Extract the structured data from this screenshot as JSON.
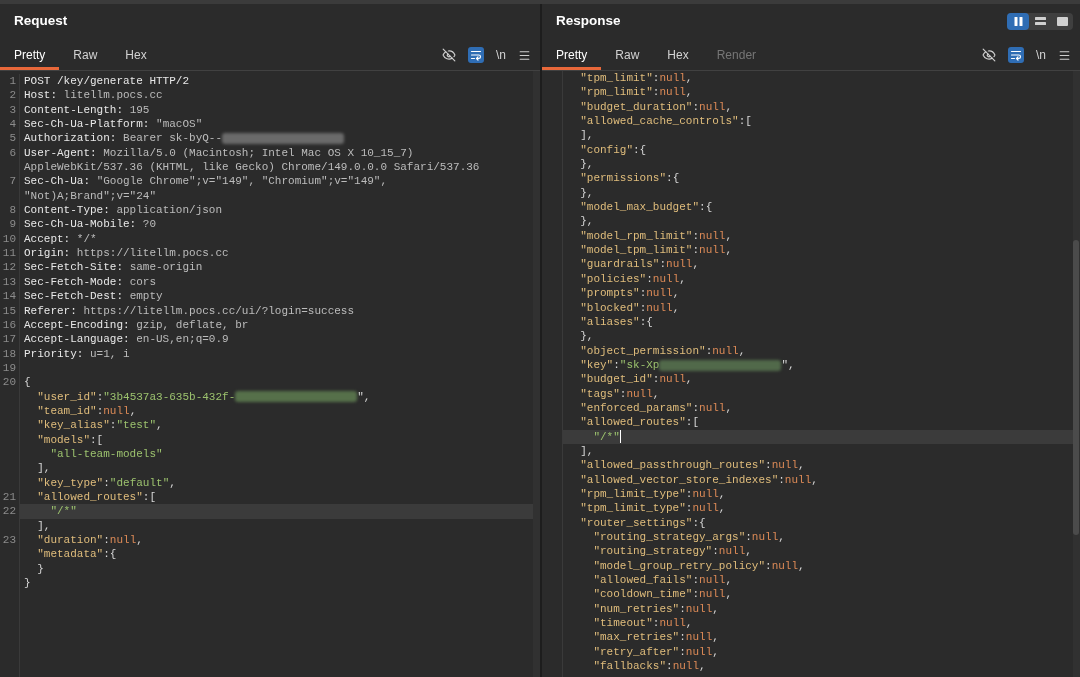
{
  "request": {
    "title": "Request",
    "tabs": [
      {
        "label": "Pretty",
        "selected": true,
        "disabled": false
      },
      {
        "label": "Raw",
        "selected": false,
        "disabled": false
      },
      {
        "label": "Hex",
        "selected": false,
        "disabled": false
      }
    ],
    "toolbar": {
      "wrap_on": true,
      "newline_label": "\\n"
    },
    "caret": false,
    "rows": [
      {
        "number": "1",
        "selected": false,
        "tokens": [
          {
            "kind": "name",
            "text": "POST /key/generate HTTP/2"
          }
        ]
      },
      {
        "number": "2",
        "selected": false,
        "tokens": [
          {
            "kind": "name",
            "text": "Host: "
          },
          {
            "kind": "value",
            "text": "litellm.pocs.cc"
          }
        ]
      },
      {
        "number": "3",
        "selected": false,
        "tokens": [
          {
            "kind": "name",
            "text": "Content-Length: "
          },
          {
            "kind": "value",
            "text": "195"
          }
        ]
      },
      {
        "number": "4",
        "selected": false,
        "tokens": [
          {
            "kind": "name",
            "text": "Sec-Ch-Ua-Platform: "
          },
          {
            "kind": "value",
            "text": "\"macOS\""
          }
        ]
      },
      {
        "number": "5",
        "selected": false,
        "tokens": [
          {
            "kind": "name",
            "text": "Authorization: "
          },
          {
            "kind": "value",
            "text": "Bearer sk-byQ--"
          },
          {
            "kind": "redacted",
            "color": "#6a6a6a"
          }
        ]
      },
      {
        "number": "6",
        "selected": false,
        "tokens": [
          {
            "kind": "name",
            "text": "User-Agent: "
          },
          {
            "kind": "value",
            "text": "Mozilla/5.0 (Macintosh; Intel Mac OS X 10_15_7)"
          }
        ]
      },
      {
        "selected": false,
        "tokens": [
          {
            "kind": "value",
            "text": "AppleWebKit/537.36 (KHTML, like Gecko) Chrome/149.0.0.0 Safari/537.36"
          }
        ]
      },
      {
        "number": "7",
        "selected": false,
        "tokens": [
          {
            "kind": "name",
            "text": "Sec-Ch-Ua: "
          },
          {
            "kind": "value",
            "text": "\"Google Chrome\";v=\"149\", \"Chromium\";v=\"149\","
          }
        ]
      },
      {
        "selected": false,
        "tokens": [
          {
            "kind": "value",
            "text": "\"Not)A;Brand\";v=\"24\""
          }
        ]
      },
      {
        "number": "8",
        "selected": false,
        "tokens": [
          {
            "kind": "name",
            "text": "Content-Type: "
          },
          {
            "kind": "value",
            "text": "application/json"
          }
        ]
      },
      {
        "number": "9",
        "selected": false,
        "tokens": [
          {
            "kind": "name",
            "text": "Sec-Ch-Ua-Mobile: "
          },
          {
            "kind": "value",
            "text": "?0"
          }
        ]
      },
      {
        "number": "10",
        "selected": false,
        "tokens": [
          {
            "kind": "name",
            "text": "Accept: "
          },
          {
            "kind": "value",
            "text": "*/*"
          }
        ]
      },
      {
        "number": "11",
        "selected": false,
        "tokens": [
          {
            "kind": "name",
            "text": "Origin: "
          },
          {
            "kind": "value",
            "text": "https://litellm.pocs.cc"
          }
        ]
      },
      {
        "number": "12",
        "selected": false,
        "tokens": [
          {
            "kind": "name",
            "text": "Sec-Fetch-Site: "
          },
          {
            "kind": "value",
            "text": "same-origin"
          }
        ]
      },
      {
        "number": "13",
        "selected": false,
        "tokens": [
          {
            "kind": "name",
            "text": "Sec-Fetch-Mode: "
          },
          {
            "kind": "value",
            "text": "cors"
          }
        ]
      },
      {
        "number": "14",
        "selected": false,
        "tokens": [
          {
            "kind": "name",
            "text": "Sec-Fetch-Dest: "
          },
          {
            "kind": "value",
            "text": "empty"
          }
        ]
      },
      {
        "number": "15",
        "selected": false,
        "tokens": [
          {
            "kind": "name",
            "text": "Referer: "
          },
          {
            "kind": "value",
            "text": "https://litellm.pocs.cc/ui/?login=success"
          }
        ]
      },
      {
        "number": "16",
        "selected": false,
        "tokens": [
          {
            "kind": "name",
            "text": "Accept-Encoding: "
          },
          {
            "kind": "value",
            "text": "gzip, deflate, br"
          }
        ]
      },
      {
        "number": "17",
        "selected": false,
        "tokens": [
          {
            "kind": "name",
            "text": "Accept-Language: "
          },
          {
            "kind": "value",
            "text": "en-US,en;q=0.9"
          }
        ]
      },
      {
        "number": "18",
        "selected": false,
        "tokens": [
          {
            "kind": "name",
            "text": "Priority: "
          },
          {
            "kind": "value",
            "text": "u=1, i"
          }
        ]
      },
      {
        "number": "19",
        "selected": false
      },
      {
        "number": "20",
        "selected": false,
        "tokens": [
          {
            "kind": "punct",
            "text": "{"
          }
        ]
      },
      {
        "selected": false,
        "tokens": [
          {
            "kind": "key",
            "text": "  \"user_id\""
          },
          {
            "kind": "punct",
            "text": ":"
          },
          {
            "kind": "string",
            "text": "\"3b4537a3-635b-432f-"
          },
          {
            "kind": "redacted",
            "color": "#56704a"
          },
          {
            "kind": "punct",
            "text": "\","
          }
        ]
      },
      {
        "selected": false,
        "tokens": [
          {
            "kind": "key",
            "text": "  \"team_id\""
          },
          {
            "kind": "punct",
            "text": ":"
          },
          {
            "kind": "null",
            "text": "null"
          },
          {
            "kind": "punct",
            "text": ","
          }
        ]
      },
      {
        "selected": false,
        "tokens": [
          {
            "kind": "key",
            "text": "  \"key_alias\""
          },
          {
            "kind": "punct",
            "text": ":"
          },
          {
            "kind": "string",
            "text": "\"test\""
          },
          {
            "kind": "punct",
            "text": ","
          }
        ]
      },
      {
        "selected": false,
        "tokens": [
          {
            "kind": "key",
            "text": "  \"models\""
          },
          {
            "kind": "punct",
            "text": ":["
          }
        ]
      },
      {
        "selected": false,
        "tokens": [
          {
            "kind": "string",
            "text": "    \"all-team-models\""
          }
        ]
      },
      {
        "selected": false,
        "tokens": [
          {
            "kind": "punct",
            "text": "  ],"
          }
        ]
      },
      {
        "selected": false,
        "tokens": [
          {
            "kind": "key",
            "text": "  \"key_type\""
          },
          {
            "kind": "punct",
            "text": ":"
          },
          {
            "kind": "string",
            "text": "\"default\""
          },
          {
            "kind": "punct",
            "text": ","
          }
        ]
      },
      {
        "number": "21",
        "selected": false,
        "tokens": [
          {
            "kind": "key",
            "text": "  \"allowed_routes\""
          },
          {
            "kind": "punct",
            "text": ":["
          }
        ]
      },
      {
        "number": "22",
        "selected": true,
        "tokens": [
          {
            "kind": "string",
            "text": "    \"/*\""
          }
        ]
      },
      {
        "selected": false,
        "tokens": [
          {
            "kind": "punct",
            "text": "  ],"
          }
        ]
      },
      {
        "number": "23",
        "selected": false,
        "tokens": [
          {
            "kind": "key",
            "text": "  \"duration\""
          },
          {
            "kind": "punct",
            "text": ":"
          },
          {
            "kind": "null",
            "text": "null"
          },
          {
            "kind": "punct",
            "text": ","
          }
        ]
      },
      {
        "selected": false,
        "tokens": [
          {
            "kind": "key",
            "text": "  \"metadata\""
          },
          {
            "kind": "punct",
            "text": ":{"
          }
        ]
      },
      {
        "selected": false,
        "tokens": [
          {
            "kind": "punct",
            "text": "  }"
          }
        ]
      },
      {
        "selected": false,
        "tokens": [
          {
            "kind": "punct",
            "text": "}"
          }
        ]
      }
    ]
  },
  "response": {
    "title": "Response",
    "layout_modes": [
      {
        "kind": "columns",
        "selected": true
      },
      {
        "kind": "rows",
        "selected": false
      },
      {
        "kind": "single",
        "selected": false
      }
    ],
    "tabs": [
      {
        "label": "Pretty",
        "selected": true,
        "disabled": false
      },
      {
        "label": "Raw",
        "selected": false,
        "disabled": false
      },
      {
        "label": "Hex",
        "selected": false,
        "disabled": false
      },
      {
        "label": "Render",
        "selected": false,
        "disabled": true
      }
    ],
    "toolbar": {
      "wrap_on": true,
      "newline_label": "\\n"
    },
    "caret": true,
    "rows": [
      {
        "selected": false,
        "tokens": [
          {
            "kind": "key",
            "text": "  \"tpm_limit\""
          },
          {
            "kind": "punct",
            "text": ":"
          },
          {
            "kind": "null",
            "text": "null"
          },
          {
            "kind": "punct",
            "text": ","
          }
        ]
      },
      {
        "selected": false,
        "tokens": [
          {
            "kind": "key",
            "text": "  \"rpm_limit\""
          },
          {
            "kind": "punct",
            "text": ":"
          },
          {
            "kind": "null",
            "text": "null"
          },
          {
            "kind": "punct",
            "text": ","
          }
        ]
      },
      {
        "selected": false,
        "tokens": [
          {
            "kind": "key",
            "text": "  \"budget_duration\""
          },
          {
            "kind": "punct",
            "text": ":"
          },
          {
            "kind": "null",
            "text": "null"
          },
          {
            "kind": "punct",
            "text": ","
          }
        ]
      },
      {
        "selected": false,
        "tokens": [
          {
            "kind": "key",
            "text": "  \"allowed_cache_controls\""
          },
          {
            "kind": "punct",
            "text": ":["
          }
        ]
      },
      {
        "selected": false,
        "tokens": [
          {
            "kind": "punct",
            "text": "  ],"
          }
        ]
      },
      {
        "selected": false,
        "tokens": [
          {
            "kind": "key",
            "text": "  \"config\""
          },
          {
            "kind": "punct",
            "text": ":{"
          }
        ]
      },
      {
        "selected": false,
        "tokens": [
          {
            "kind": "punct",
            "text": "  },"
          }
        ]
      },
      {
        "selected": false,
        "tokens": [
          {
            "kind": "key",
            "text": "  \"permissions\""
          },
          {
            "kind": "punct",
            "text": ":{"
          }
        ]
      },
      {
        "selected": false,
        "tokens": [
          {
            "kind": "punct",
            "text": "  },"
          }
        ]
      },
      {
        "selected": false,
        "tokens": [
          {
            "kind": "key",
            "text": "  \"model_max_budget\""
          },
          {
            "kind": "punct",
            "text": ":{"
          }
        ]
      },
      {
        "selected": false,
        "tokens": [
          {
            "kind": "punct",
            "text": "  },"
          }
        ]
      },
      {
        "selected": false,
        "tokens": [
          {
            "kind": "key",
            "text": "  \"model_rpm_limit\""
          },
          {
            "kind": "punct",
            "text": ":"
          },
          {
            "kind": "null",
            "text": "null"
          },
          {
            "kind": "punct",
            "text": ","
          }
        ]
      },
      {
        "selected": false,
        "tokens": [
          {
            "kind": "key",
            "text": "  \"model_tpm_limit\""
          },
          {
            "kind": "punct",
            "text": ":"
          },
          {
            "kind": "null",
            "text": "null"
          },
          {
            "kind": "punct",
            "text": ","
          }
        ]
      },
      {
        "selected": false,
        "tokens": [
          {
            "kind": "key",
            "text": "  \"guardrails\""
          },
          {
            "kind": "punct",
            "text": ":"
          },
          {
            "kind": "null",
            "text": "null"
          },
          {
            "kind": "punct",
            "text": ","
          }
        ]
      },
      {
        "selected": false,
        "tokens": [
          {
            "kind": "key",
            "text": "  \"policies\""
          },
          {
            "kind": "punct",
            "text": ":"
          },
          {
            "kind": "null",
            "text": "null"
          },
          {
            "kind": "punct",
            "text": ","
          }
        ]
      },
      {
        "selected": false,
        "tokens": [
          {
            "kind": "key",
            "text": "  \"prompts\""
          },
          {
            "kind": "punct",
            "text": ":"
          },
          {
            "kind": "null",
            "text": "null"
          },
          {
            "kind": "punct",
            "text": ","
          }
        ]
      },
      {
        "selected": false,
        "tokens": [
          {
            "kind": "key",
            "text": "  \"blocked\""
          },
          {
            "kind": "punct",
            "text": ":"
          },
          {
            "kind": "null",
            "text": "null"
          },
          {
            "kind": "punct",
            "text": ","
          }
        ]
      },
      {
        "selected": false,
        "tokens": [
          {
            "kind": "key",
            "text": "  \"aliases\""
          },
          {
            "kind": "punct",
            "text": ":{"
          }
        ]
      },
      {
        "selected": false,
        "tokens": [
          {
            "kind": "punct",
            "text": "  },"
          }
        ]
      },
      {
        "selected": false,
        "tokens": [
          {
            "kind": "key",
            "text": "  \"object_permission\""
          },
          {
            "kind": "punct",
            "text": ":"
          },
          {
            "kind": "null",
            "text": "null"
          },
          {
            "kind": "punct",
            "text": ","
          }
        ]
      },
      {
        "selected": false,
        "tokens": [
          {
            "kind": "key",
            "text": "  \"key\""
          },
          {
            "kind": "punct",
            "text": ":"
          },
          {
            "kind": "string",
            "text": "\"sk-Xp"
          },
          {
            "kind": "redacted",
            "color": "#51694a"
          },
          {
            "kind": "punct",
            "text": "\","
          }
        ]
      },
      {
        "selected": false,
        "tokens": [
          {
            "kind": "key",
            "text": "  \"budget_id\""
          },
          {
            "kind": "punct",
            "text": ":"
          },
          {
            "kind": "null",
            "text": "null"
          },
          {
            "kind": "punct",
            "text": ","
          }
        ]
      },
      {
        "selected": false,
        "tokens": [
          {
            "kind": "key",
            "text": "  \"tags\""
          },
          {
            "kind": "punct",
            "text": ":"
          },
          {
            "kind": "null",
            "text": "null"
          },
          {
            "kind": "punct",
            "text": ","
          }
        ]
      },
      {
        "selected": false,
        "tokens": [
          {
            "kind": "key",
            "text": "  \"enforced_params\""
          },
          {
            "kind": "punct",
            "text": ":"
          },
          {
            "kind": "null",
            "text": "null"
          },
          {
            "kind": "punct",
            "text": ","
          }
        ]
      },
      {
        "selected": false,
        "tokens": [
          {
            "kind": "key",
            "text": "  \"allowed_routes\""
          },
          {
            "kind": "punct",
            "text": ":["
          }
        ]
      },
      {
        "selected": true,
        "tokens": [
          {
            "kind": "string",
            "text": "    \"/*\""
          }
        ]
      },
      {
        "selected": false,
        "tokens": [
          {
            "kind": "punct",
            "text": "  ],"
          }
        ]
      },
      {
        "selected": false,
        "tokens": [
          {
            "kind": "key",
            "text": "  \"allowed_passthrough_routes\""
          },
          {
            "kind": "punct",
            "text": ":"
          },
          {
            "kind": "null",
            "text": "null"
          },
          {
            "kind": "punct",
            "text": ","
          }
        ]
      },
      {
        "selected": false,
        "tokens": [
          {
            "kind": "key",
            "text": "  \"allowed_vector_store_indexes\""
          },
          {
            "kind": "punct",
            "text": ":"
          },
          {
            "kind": "null",
            "text": "null"
          },
          {
            "kind": "punct",
            "text": ","
          }
        ]
      },
      {
        "selected": false,
        "tokens": [
          {
            "kind": "key",
            "text": "  \"rpm_limit_type\""
          },
          {
            "kind": "punct",
            "text": ":"
          },
          {
            "kind": "null",
            "text": "null"
          },
          {
            "kind": "punct",
            "text": ","
          }
        ]
      },
      {
        "selected": false,
        "tokens": [
          {
            "kind": "key",
            "text": "  \"tpm_limit_type\""
          },
          {
            "kind": "punct",
            "text": ":"
          },
          {
            "kind": "null",
            "text": "null"
          },
          {
            "kind": "punct",
            "text": ","
          }
        ]
      },
      {
        "selected": false,
        "tokens": [
          {
            "kind": "key",
            "text": "  \"router_settings\""
          },
          {
            "kind": "punct",
            "text": ":{"
          }
        ]
      },
      {
        "selected": false,
        "tokens": [
          {
            "kind": "key",
            "text": "    \"routing_strategy_args\""
          },
          {
            "kind": "punct",
            "text": ":"
          },
          {
            "kind": "null",
            "text": "null"
          },
          {
            "kind": "punct",
            "text": ","
          }
        ]
      },
      {
        "selected": false,
        "tokens": [
          {
            "kind": "key",
            "text": "    \"routing_strategy\""
          },
          {
            "kind": "punct",
            "text": ":"
          },
          {
            "kind": "null",
            "text": "null"
          },
          {
            "kind": "punct",
            "text": ","
          }
        ]
      },
      {
        "selected": false,
        "tokens": [
          {
            "kind": "key",
            "text": "    \"model_group_retry_policy\""
          },
          {
            "kind": "punct",
            "text": ":"
          },
          {
            "kind": "null",
            "text": "null"
          },
          {
            "kind": "punct",
            "text": ","
          }
        ]
      },
      {
        "selected": false,
        "tokens": [
          {
            "kind": "key",
            "text": "    \"allowed_fails\""
          },
          {
            "kind": "punct",
            "text": ":"
          },
          {
            "kind": "null",
            "text": "null"
          },
          {
            "kind": "punct",
            "text": ","
          }
        ]
      },
      {
        "selected": false,
        "tokens": [
          {
            "kind": "key",
            "text": "    \"cooldown_time\""
          },
          {
            "kind": "punct",
            "text": ":"
          },
          {
            "kind": "null",
            "text": "null"
          },
          {
            "kind": "punct",
            "text": ","
          }
        ]
      },
      {
        "selected": false,
        "tokens": [
          {
            "kind": "key",
            "text": "    \"num_retries\""
          },
          {
            "kind": "punct",
            "text": ":"
          },
          {
            "kind": "null",
            "text": "null"
          },
          {
            "kind": "punct",
            "text": ","
          }
        ]
      },
      {
        "selected": false,
        "tokens": [
          {
            "kind": "key",
            "text": "    \"timeout\""
          },
          {
            "kind": "punct",
            "text": ":"
          },
          {
            "kind": "null",
            "text": "null"
          },
          {
            "kind": "punct",
            "text": ","
          }
        ]
      },
      {
        "selected": false,
        "tokens": [
          {
            "kind": "key",
            "text": "    \"max_retries\""
          },
          {
            "kind": "punct",
            "text": ":"
          },
          {
            "kind": "null",
            "text": "null"
          },
          {
            "kind": "punct",
            "text": ","
          }
        ]
      },
      {
        "selected": false,
        "tokens": [
          {
            "kind": "key",
            "text": "    \"retry_after\""
          },
          {
            "kind": "punct",
            "text": ":"
          },
          {
            "kind": "null",
            "text": "null"
          },
          {
            "kind": "punct",
            "text": ","
          }
        ]
      },
      {
        "selected": false,
        "tokens": [
          {
            "kind": "key",
            "text": "    \"fallbacks\""
          },
          {
            "kind": "punct",
            "text": ":"
          },
          {
            "kind": "null",
            "text": "null"
          },
          {
            "kind": "punct",
            "text": ","
          }
        ]
      }
    ]
  }
}
